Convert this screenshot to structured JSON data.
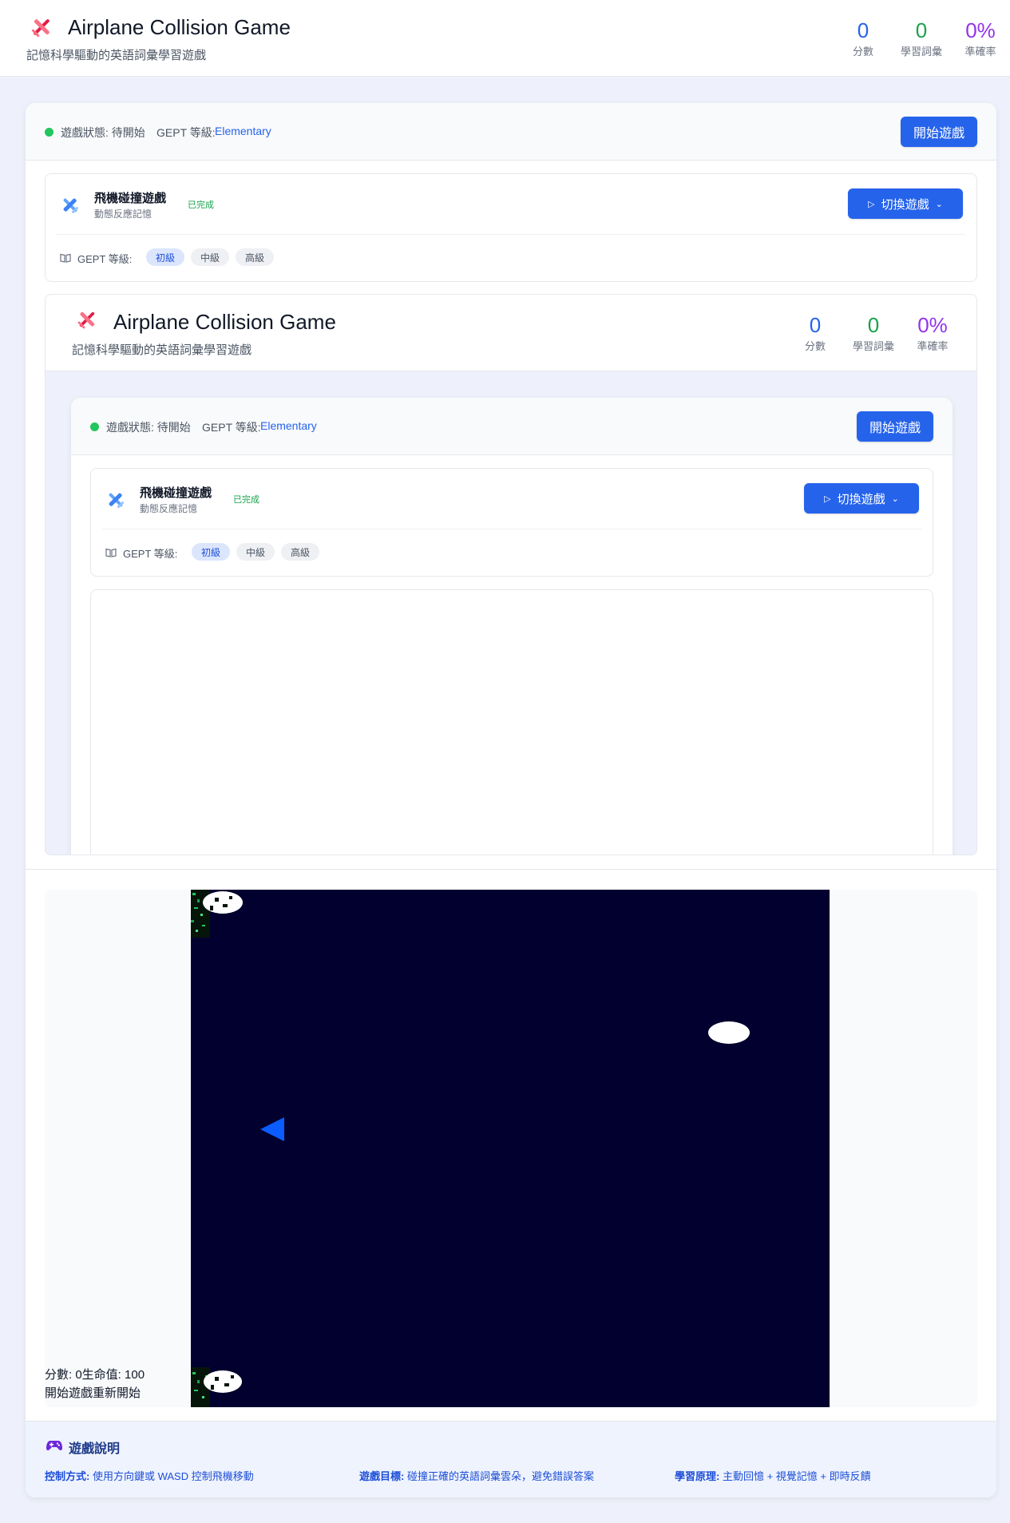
{
  "header": {
    "title": "Airplane Collision Game",
    "subtitle": "記憶科學驅動的英語詞彙學習遊戲",
    "stats": [
      {
        "value": "0",
        "label": "分數",
        "color": "#2563eb"
      },
      {
        "value": "0",
        "label": "學習詞彙",
        "color": "#16a34a"
      },
      {
        "value": "0%",
        "label": "準確率",
        "color": "#9333ea"
      }
    ]
  },
  "status_bar": {
    "status": "遊戲狀態: 待開始",
    "level_label": "GEPT 等級:",
    "level_value": "Elementary",
    "start_button": "開始遊戲"
  },
  "game_card": {
    "title": "飛機碰撞遊戲",
    "subtitle": "動態反應記憶",
    "badge": "已完成",
    "switch_button": "切換遊戲",
    "level_label": "GEPT 等級:",
    "levels": [
      "初級",
      "中級",
      "高級"
    ],
    "active_level": "初級"
  },
  "game_canvas": {
    "hud_line1": "分數: 0生命值: 100",
    "hud_line2": "開始遊戲重新開始"
  },
  "instructions": {
    "title": "遊戲說明",
    "items": [
      {
        "label": "控制方式:",
        "text": "使用方向鍵或 WASD 控制飛機移動"
      },
      {
        "label": "遊戲目標:",
        "text": "碰撞正確的英語詞彙雲朵，避免錯誤答案"
      },
      {
        "label": "學習原理:",
        "text": "主動回憶 + 視覺記憶 + 即時反饋"
      }
    ]
  },
  "colors": {
    "accent": "#2563eb",
    "canvas_bg": "#02002e",
    "player": "#0a5cff"
  }
}
